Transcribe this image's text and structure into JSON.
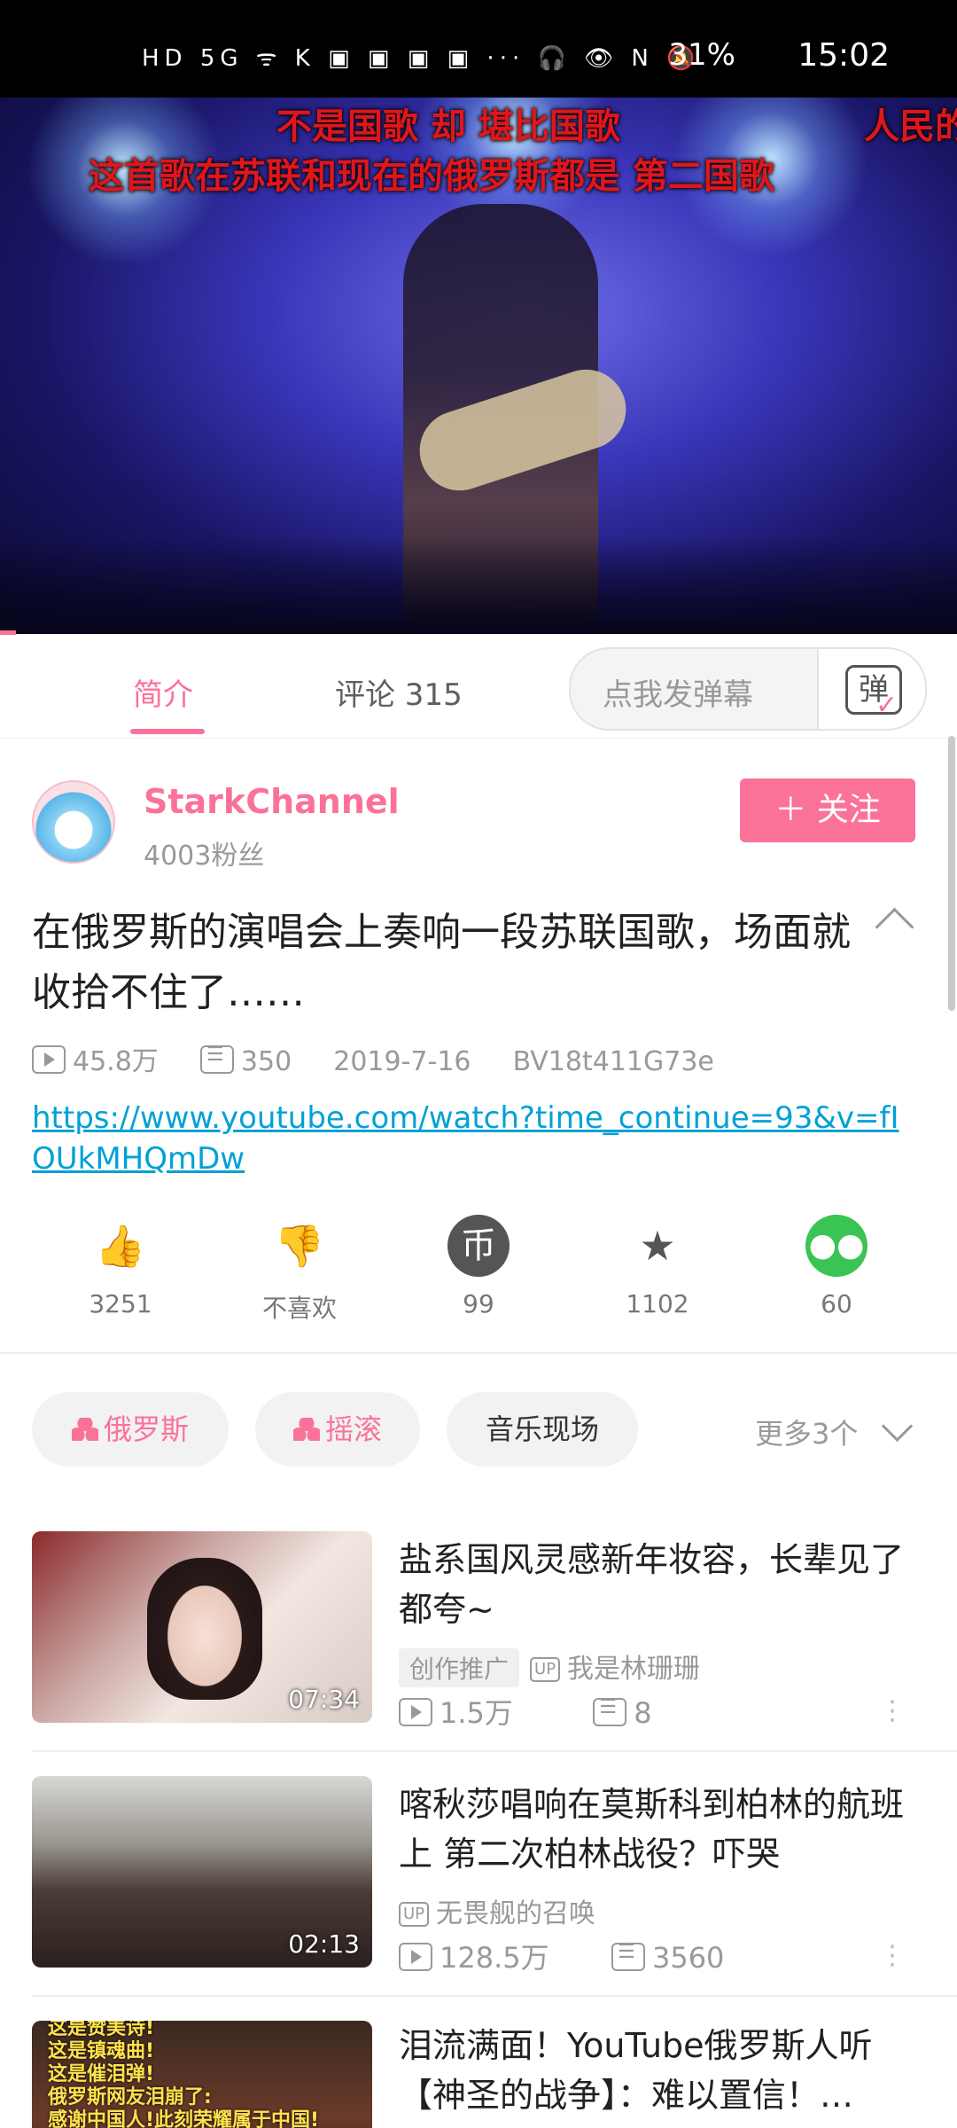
{
  "status_bar": {
    "icons": "HD 5G ᯤ K ▣ ▣ ▣ ▣ ··· 🎧 👁 N 🔕",
    "battery": "31%",
    "time": "15:02"
  },
  "video": {
    "subtitle_line1": "不是国歌  却  堪比国歌",
    "subtitle_right": "人民的",
    "subtitle_line2": "这首歌在苏联和现在的俄罗斯都是  第二国歌"
  },
  "tabs": {
    "intro": "简介",
    "comments": "评论 315",
    "danmaku_placeholder": "点我发弹幕",
    "danmaku_icon": "弹"
  },
  "uploader": {
    "name": "StarkChannel",
    "fans": "4003粉丝",
    "follow_label": "＋ 关注"
  },
  "video_info": {
    "title": "在俄罗斯的演唱会上奏响一段苏联国歌，场面就收拾不住了……",
    "views": "45.8万",
    "danmaku_count": "350",
    "date": "2019-7-16",
    "bvid": "BV18t411G73e",
    "link": "https://www.youtube.com/watch?time_continue=93&v=fIOUkMHQmDw"
  },
  "actions": [
    {
      "icon": "thumbs-up-icon",
      "label": "3251"
    },
    {
      "icon": "thumbs-down-icon",
      "label": "不喜欢"
    },
    {
      "icon": "coin-icon",
      "label": "99"
    },
    {
      "icon": "star-icon",
      "label": "1102"
    },
    {
      "icon": "wechat-icon",
      "label": "60"
    }
  ],
  "tags": [
    {
      "label": "俄罗斯",
      "pink": true
    },
    {
      "label": "摇滚",
      "pink": true
    },
    {
      "label": "音乐现场",
      "pink": false
    }
  ],
  "more_tags": "更多3个",
  "related": [
    {
      "title": "盐系国风灵感新年妆容，长辈见了都夸~",
      "duration": "07:34",
      "promo": "创作推广",
      "up_badge": "UP",
      "uploader": "我是林珊珊",
      "views": "1.5万",
      "danmaku": "8"
    },
    {
      "title": "喀秋莎唱响在莫斯科到柏林的航班上 第二次柏林战役？吓哭",
      "duration": "02:13",
      "up_badge": "UP",
      "uploader": "无畏舰的召唤",
      "views": "128.5万",
      "danmaku": "3560"
    },
    {
      "title": "泪流满面！YouTube俄罗斯人听【神圣的战争】：难以置信！…",
      "thumb_text": "这是赞美诗!\n这是镇魂曲!\n这是催泪弹!\n俄罗斯网友泪崩了:\n感谢中国人!此刻荣耀属于中国!"
    }
  ],
  "colors": {
    "accent": "#fb7299",
    "link": "#00a1d6",
    "subtitle": "#e0161c"
  }
}
